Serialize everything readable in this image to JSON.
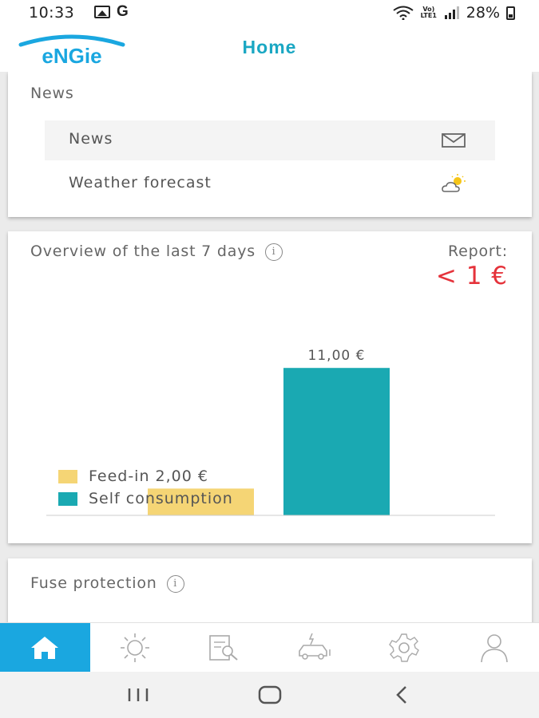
{
  "status_bar": {
    "time": "10:33",
    "g_label": "G",
    "network_label": "Vo) LTE1",
    "battery": "28%"
  },
  "header": {
    "logo_text": "eNGie",
    "title": "Home"
  },
  "news_card": {
    "title": "News",
    "items": [
      {
        "label": "News",
        "icon": "mail-icon"
      },
      {
        "label": "Weather forecast",
        "icon": "weather-icon"
      }
    ]
  },
  "overview_card": {
    "title": "Overview of the last 7 days",
    "report_label": "Report:",
    "report_value": "< 1 €"
  },
  "chart_data": {
    "type": "bar",
    "categories": [
      "Feed-in",
      "Self consumption"
    ],
    "values": [
      2.0,
      11.0
    ],
    "value_labels": [
      "",
      "11,00 €"
    ],
    "legend": [
      {
        "label": "Feed-in 2,00 €",
        "color": "#f5d575"
      },
      {
        "label": "Self consumption",
        "color": "#1aa9b2"
      }
    ],
    "ylim": [
      0,
      12.5
    ],
    "legend_position": "bottom-left"
  },
  "fuse_card": {
    "title": "Fuse protection"
  },
  "bottom_nav": {
    "items": [
      {
        "icon": "home-icon",
        "active": true
      },
      {
        "icon": "sun-icon",
        "active": false
      },
      {
        "icon": "report-search-icon",
        "active": false
      },
      {
        "icon": "ev-car-icon",
        "active": false
      },
      {
        "icon": "gear-icon",
        "active": false
      },
      {
        "icon": "user-icon",
        "active": false
      }
    ]
  },
  "colors": {
    "accent": "#1aa7c3",
    "nav_active": "#1aa7e0",
    "report_red": "#e5333b",
    "feed_in": "#f5d575",
    "self_consumption": "#1aa9b2"
  }
}
